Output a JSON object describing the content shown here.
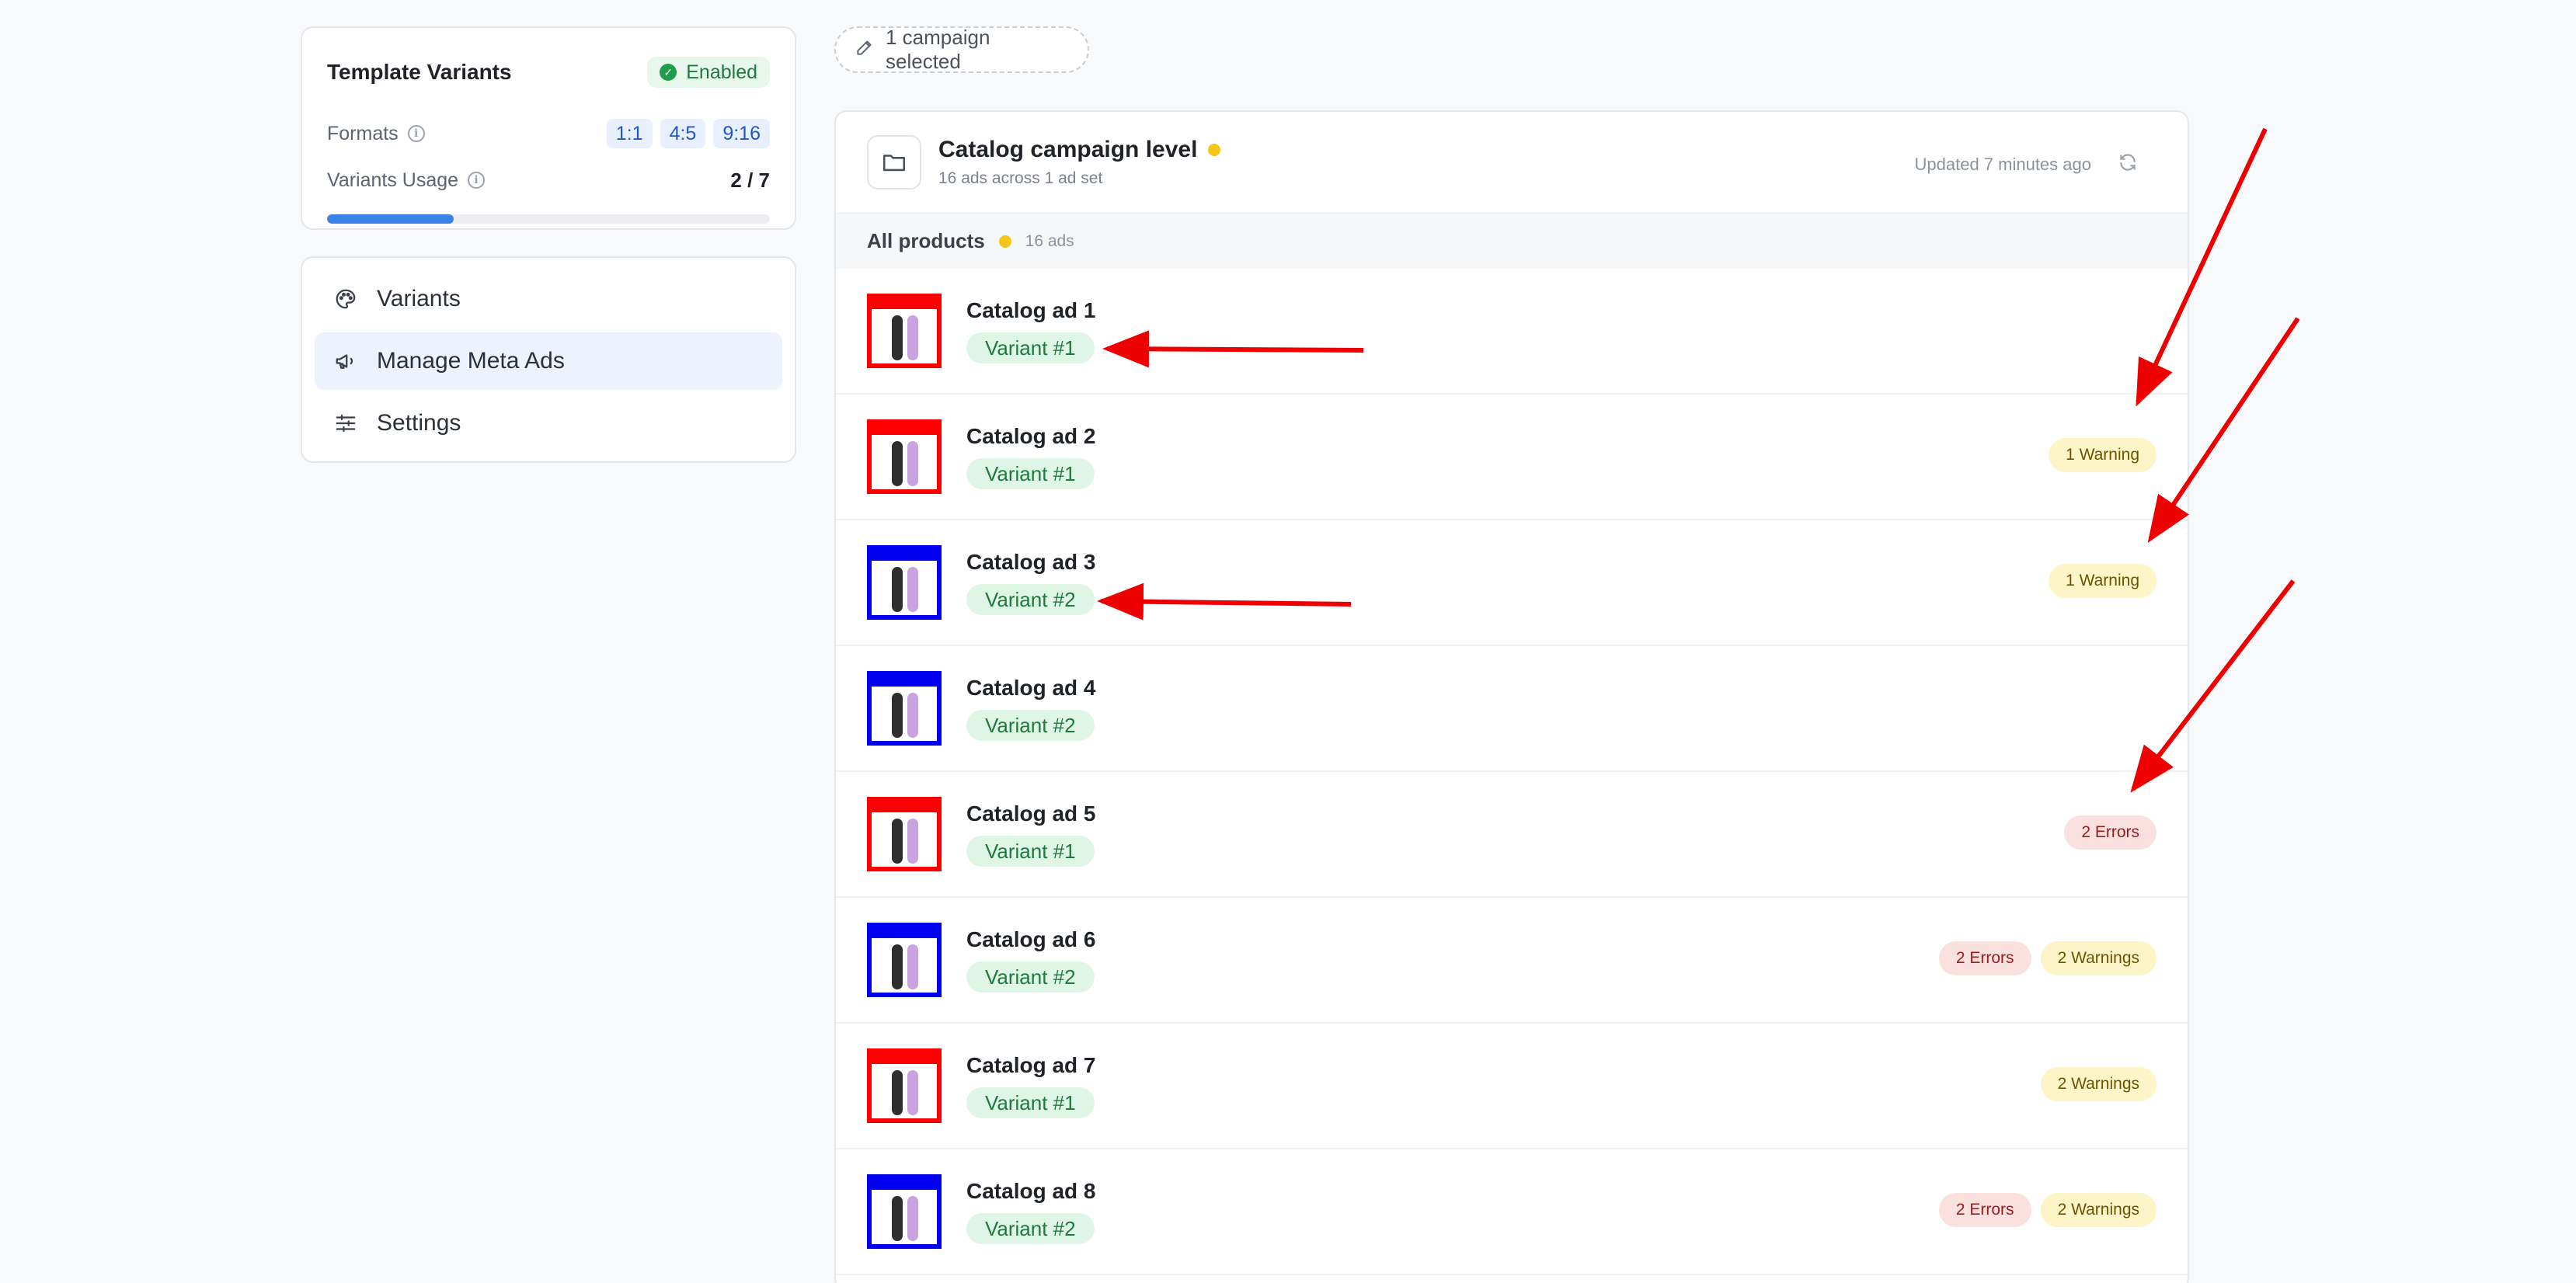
{
  "template_variants": {
    "title": "Template Variants",
    "status": "Enabled",
    "formats_label": "Formats",
    "formats": [
      "1:1",
      "4:5",
      "9:16"
    ],
    "usage_label": "Variants Usage",
    "usage_value": "2 / 7",
    "usage_fraction": 0.2857
  },
  "nav": {
    "items": [
      {
        "label": "Variants",
        "icon": "palette-icon"
      },
      {
        "label": "Manage Meta Ads",
        "icon": "megaphone-icon",
        "active": true
      },
      {
        "label": "Settings",
        "icon": "sliders-icon"
      }
    ]
  },
  "selection_chip": "1 campaign selected",
  "campaign": {
    "title": "Catalog campaign level",
    "subtitle": "16 ads across 1 ad set",
    "updated": "Updated 7 minutes ago"
  },
  "group": {
    "name": "All products",
    "count": "16 ads"
  },
  "ads": [
    {
      "name": "Catalog ad 1",
      "variant": "Variant #1",
      "color": "red",
      "badges": []
    },
    {
      "name": "Catalog ad 2",
      "variant": "Variant #1",
      "color": "red",
      "badges": [
        {
          "type": "warn",
          "label": "1 Warning"
        }
      ]
    },
    {
      "name": "Catalog ad 3",
      "variant": "Variant #2",
      "color": "blue",
      "badges": [
        {
          "type": "warn",
          "label": "1 Warning"
        }
      ]
    },
    {
      "name": "Catalog ad 4",
      "variant": "Variant #2",
      "color": "blue",
      "badges": []
    },
    {
      "name": "Catalog ad 5",
      "variant": "Variant #1",
      "color": "red",
      "badges": [
        {
          "type": "err",
          "label": "2 Errors"
        }
      ]
    },
    {
      "name": "Catalog ad 6",
      "variant": "Variant #2",
      "color": "blue",
      "badges": [
        {
          "type": "err",
          "label": "2 Errors"
        },
        {
          "type": "warn",
          "label": "2 Warnings"
        }
      ]
    },
    {
      "name": "Catalog ad 7",
      "variant": "Variant #1",
      "color": "red",
      "badges": [
        {
          "type": "warn",
          "label": "2 Warnings"
        }
      ]
    },
    {
      "name": "Catalog ad 8",
      "variant": "Variant #2",
      "color": "blue",
      "badges": [
        {
          "type": "err",
          "label": "2 Errors"
        },
        {
          "type": "warn",
          "label": "2 Warnings"
        }
      ]
    }
  ],
  "colors": {
    "accent": "#3b82e8",
    "thumb_red": "#ff0000",
    "thumb_blue": "#0000ee",
    "annotation_arrow": "#ee0000"
  }
}
